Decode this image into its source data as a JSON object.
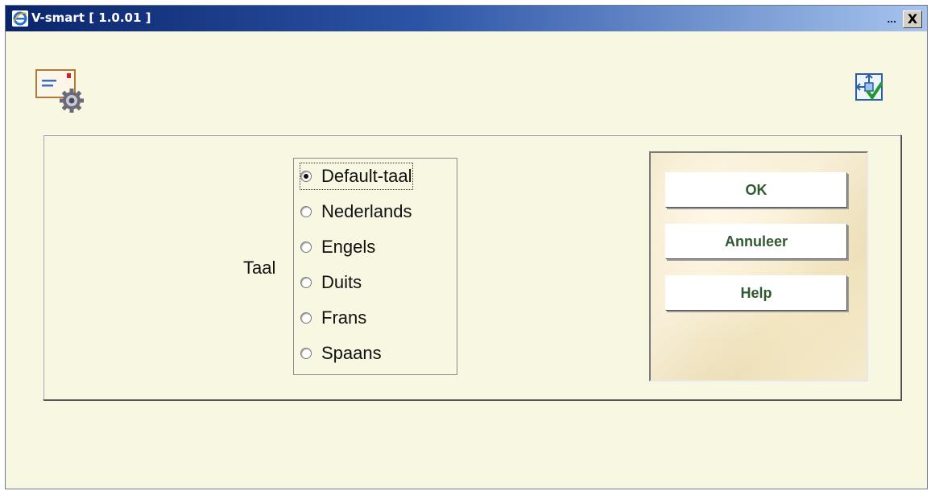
{
  "window": {
    "title": "V-smart [ 1.0.01 ]",
    "dots": "...",
    "close_label": "X"
  },
  "toolbar": {
    "left_icon": "options-settings-icon",
    "right_icon": "confirm-icon"
  },
  "form": {
    "language_label": "Taal",
    "options": [
      {
        "label": "Default-taal",
        "checked": true
      },
      {
        "label": "Nederlands",
        "checked": false
      },
      {
        "label": "Engels",
        "checked": false
      },
      {
        "label": "Duits",
        "checked": false
      },
      {
        "label": "Frans",
        "checked": false
      },
      {
        "label": "Spaans",
        "checked": false
      }
    ]
  },
  "buttons": {
    "ok": "OK",
    "cancel": "Annuleer",
    "help": "Help"
  },
  "colors": {
    "background": "#f7f7e2",
    "titlebar_start": "#0a246a",
    "titlebar_end": "#a6c4ee",
    "button_text": "#2e5a2e"
  }
}
